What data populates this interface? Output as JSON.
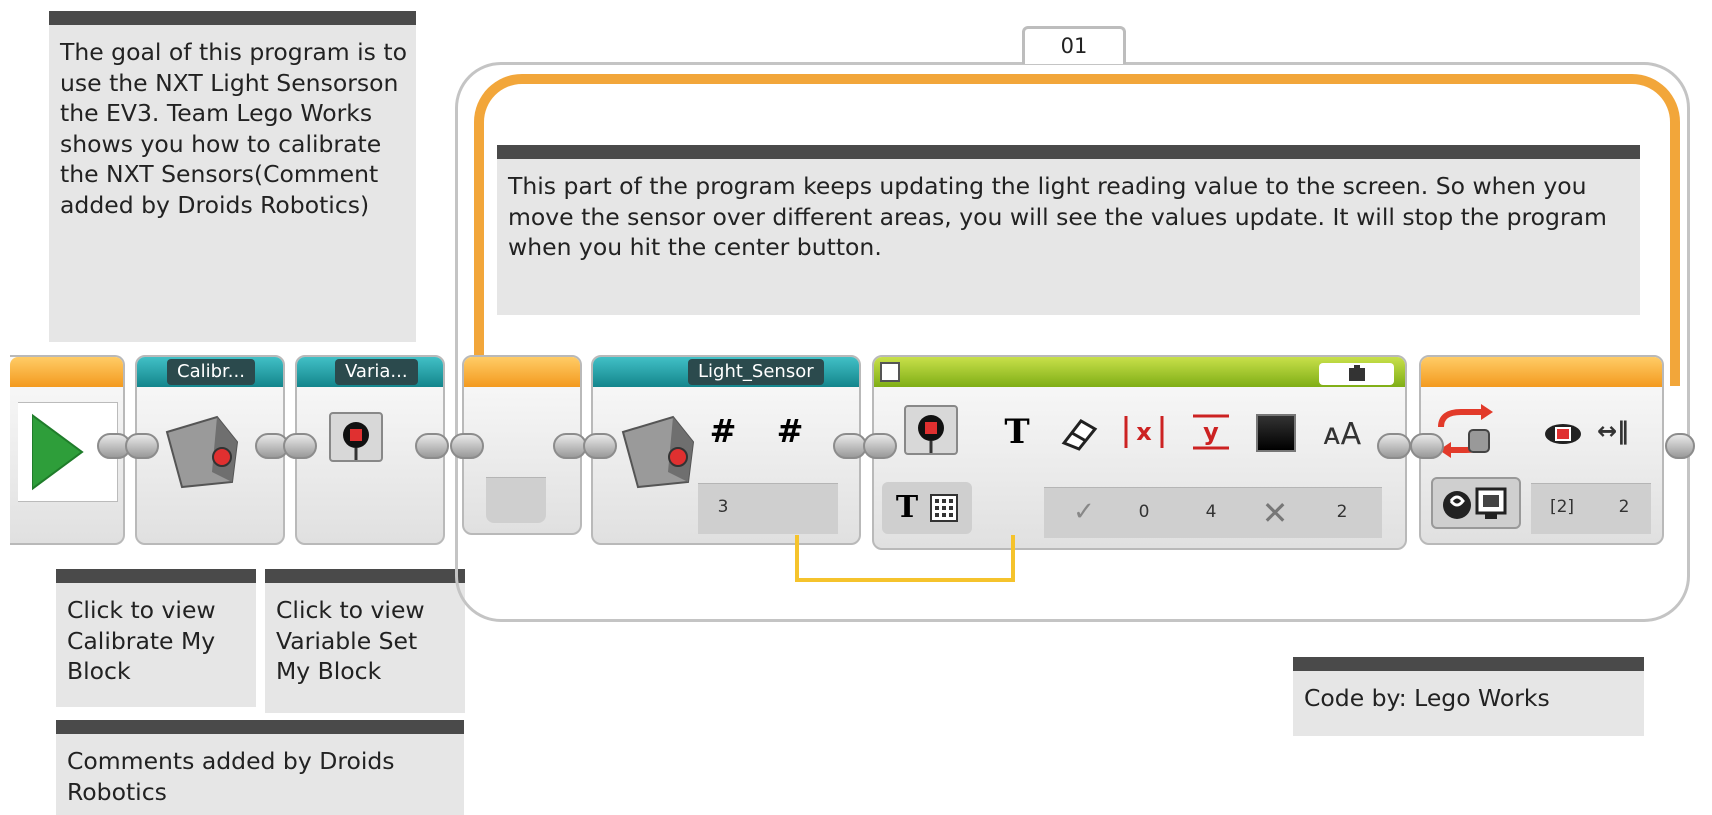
{
  "comments": {
    "goal": "The goal of this program is to use the NXT Light Sensorson the EV3.  Team Lego Works shows you how to calibrate the NXT Sensors(Comment added by Droids Robotics)",
    "loop_note": "This part of the program keeps updating the light reading value to the screen. So when you move the sensor over different areas, you will see the values update. It will stop the program when you hit the center button.",
    "calibrate_link": "Click to view Calibrate My Block",
    "variable_link": "Click to view Variable Set My Block",
    "droids": "Comments added by Droids Robotics",
    "code_by": "Code by: Lego Works"
  },
  "loop": {
    "counter": "01"
  },
  "blocks": {
    "calibrate": {
      "label": "Calibr..."
    },
    "variable": {
      "label": "Varia..."
    },
    "light_sensor": {
      "label": "Light_Sensor",
      "port": "3",
      "outputs": [
        "#",
        "#"
      ]
    },
    "display": {
      "mode_text": "T",
      "params": [
        "0",
        "4",
        "2"
      ]
    },
    "loop_exit": {
      "params": [
        "[2]",
        "2"
      ]
    }
  },
  "colors": {
    "flow_orange": "#f39a1f",
    "teal_header": "#1a8d94",
    "green_header": "#8cbf1e",
    "wire_yellow": "#f5c32c",
    "comment_bg": "#e6e6e6",
    "comment_bar": "#4a4a4a"
  }
}
